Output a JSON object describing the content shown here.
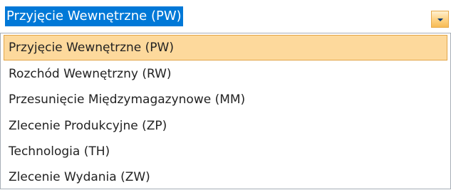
{
  "combo": {
    "selected_label": "Przyjęcie Wewnętrzne (PW)",
    "icon": "chevron-down-icon"
  },
  "options": [
    {
      "label": "Przyjęcie Wewnętrzne (PW)",
      "highlighted": true
    },
    {
      "label": "Rozchód Wewnętrzny (RW)",
      "highlighted": false
    },
    {
      "label": "Przesunięcie Międzymagazynowe (MM)",
      "highlighted": false
    },
    {
      "label": "Zlecenie Produkcyjne (ZP)",
      "highlighted": false
    },
    {
      "label": "Technologia (TH)",
      "highlighted": false
    },
    {
      "label": "Zlecenie Wydania (ZW)",
      "highlighted": false
    }
  ],
  "colors": {
    "selection": "#0078d7",
    "highlight": "#fdd99c",
    "highlight_border": "#e2a547",
    "button": "#f7bc55"
  }
}
